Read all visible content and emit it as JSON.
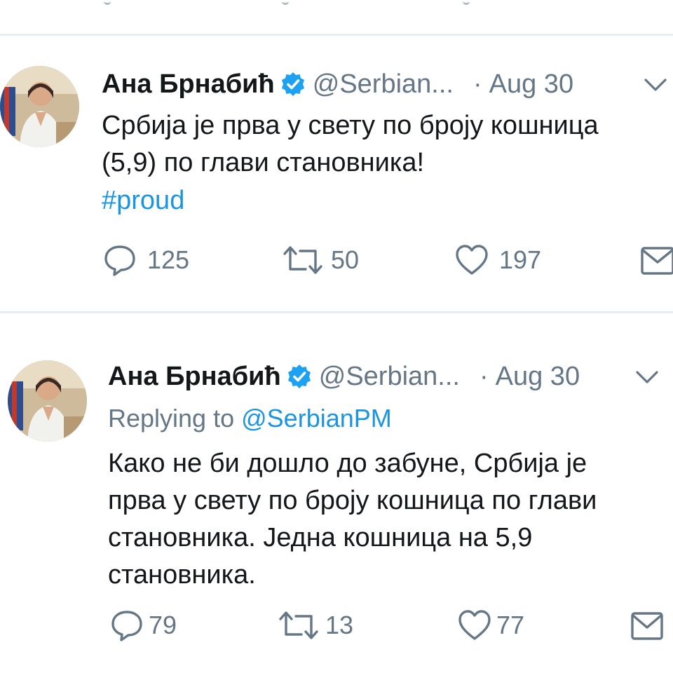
{
  "tweets": [
    {
      "author_name": "Ана Брнабић",
      "handle": "@SerbianPM",
      "handle_truncated": "@Serbian...",
      "separator": "·",
      "date": "Aug 30",
      "text": "Србија је прва у свету по броју кошница\n(5,9) по глави становника!",
      "hashtag": "#proud",
      "replies": "125",
      "retweets": "50",
      "likes": "197"
    },
    {
      "author_name": "Ана Брнабић",
      "handle": "@SerbianPM",
      "handle_truncated": "@Serbian...",
      "separator": "·",
      "date": "Aug 30",
      "replying_label": "Replying to",
      "replying_mention": "@SerbianPM",
      "text": "Како не би дошло до забуне, Србија је\nпрва у свету по броју кошница по глави\nстановника. Једна кошница на 5,9\nстановника.",
      "replies": "79",
      "retweets": "13",
      "likes": "77"
    }
  ],
  "colors": {
    "primary_text": "#14171a",
    "secondary_text": "#657786",
    "link": "#1b95e0",
    "verified": "#1da1f2",
    "divider": "#e6ecf0"
  },
  "icons": {
    "verified": "verified-badge-icon",
    "caret": "chevron-down-icon",
    "reply": "reply-bubble-icon",
    "retweet": "retweet-icon",
    "like": "heart-icon",
    "dm": "envelope-icon"
  }
}
